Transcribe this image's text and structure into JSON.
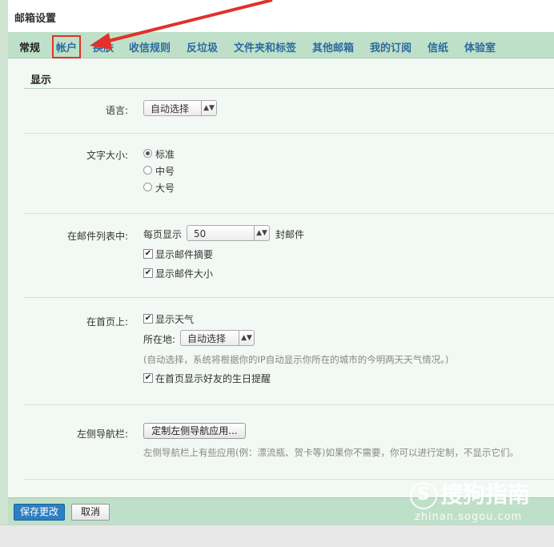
{
  "window": {
    "title": "邮箱设置"
  },
  "tabs": [
    {
      "label": "常规",
      "active": true
    },
    {
      "label": "帐户",
      "highlighted": true
    },
    {
      "label": "换肤"
    },
    {
      "label": "收信规则"
    },
    {
      "label": "反垃圾"
    },
    {
      "label": "文件夹和标签"
    },
    {
      "label": "其他邮箱"
    },
    {
      "label": "我的订阅"
    },
    {
      "label": "信纸"
    },
    {
      "label": "体验室"
    }
  ],
  "section": {
    "title": "显示"
  },
  "language": {
    "label": "语言:",
    "value": "自动选择"
  },
  "font_size": {
    "label": "文字大小:",
    "options": [
      "标准",
      "中号",
      "大号"
    ],
    "selected": "标准"
  },
  "mail_list": {
    "label": "在邮件列表中:",
    "per_page_prefix": "每页显示",
    "per_page_value": "50",
    "per_page_suffix": "封邮件",
    "show_summary": {
      "label": "显示邮件摘要",
      "checked": true
    },
    "show_size": {
      "label": "显示邮件大小",
      "checked": true
    }
  },
  "homepage": {
    "label": "在首页上:",
    "show_weather": {
      "label": "显示天气",
      "checked": true
    },
    "location_label": "所在地:",
    "location_value": "自动选择",
    "location_hint": "(自动选择，系统将根据你的IP自动显示你所在的城市的今明两天天气情况。)",
    "birthday": {
      "label": "在首页显示好友的生日提醒",
      "checked": true
    }
  },
  "left_nav": {
    "label": "左侧导航栏:",
    "button": "定制左侧导航应用...",
    "hint": "左侧导航栏上有些应用(例：漂流瓶、贺卡等)如果你不需要，你可以进行定制，不显示它们。"
  },
  "footer": {
    "save": "保存更改",
    "cancel": "取消"
  },
  "watermark": {
    "brand": "搜狗指南",
    "logo_letter": "S",
    "url": "zhinan.sogou.com"
  },
  "colors": {
    "accent": "#2c7fc2",
    "tab_bar": "#bfe0c8",
    "highlight": "#e0312a"
  }
}
